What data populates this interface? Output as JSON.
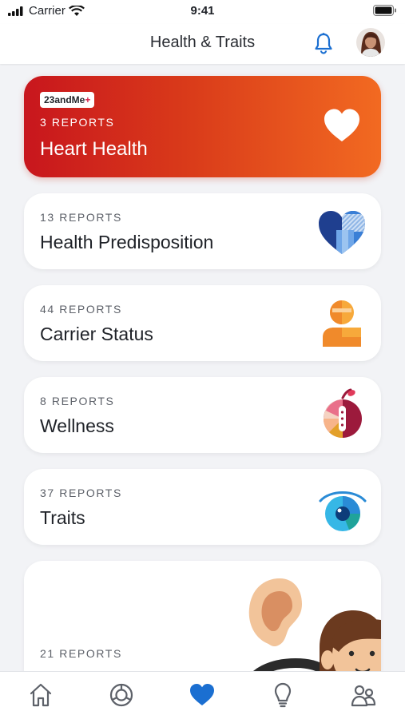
{
  "status_bar": {
    "carrier": "Carrier",
    "time": "9:41"
  },
  "header": {
    "title": "Health & Traits"
  },
  "hero_card": {
    "badge_brand": "23andMe",
    "badge_plus": "+",
    "count": "3 REPORTS",
    "title": "Heart Health"
  },
  "cards": [
    {
      "count": "13 REPORTS",
      "title": "Health Predisposition",
      "icon": "heart-pattern-icon"
    },
    {
      "count": "44 REPORTS",
      "title": "Carrier Status",
      "icon": "person-icon"
    },
    {
      "count": "8 REPORTS",
      "title": "Wellness",
      "icon": "apple-icon"
    },
    {
      "count": "37 REPORTS",
      "title": "Traits",
      "icon": "eye-icon"
    },
    {
      "count": "21 REPORTS",
      "title": "",
      "icon": "ear-face-illustration"
    }
  ],
  "tab_bar": {
    "items": [
      "home-icon",
      "ancestry-icon",
      "health-heart-icon",
      "lightbulb-icon",
      "family-icon"
    ],
    "active": "health-heart-icon",
    "active_color": "#1b6fd1"
  },
  "colors": {
    "accent": "#1b6fd1",
    "hero_start": "#c8161d",
    "hero_end": "#f26a21"
  }
}
